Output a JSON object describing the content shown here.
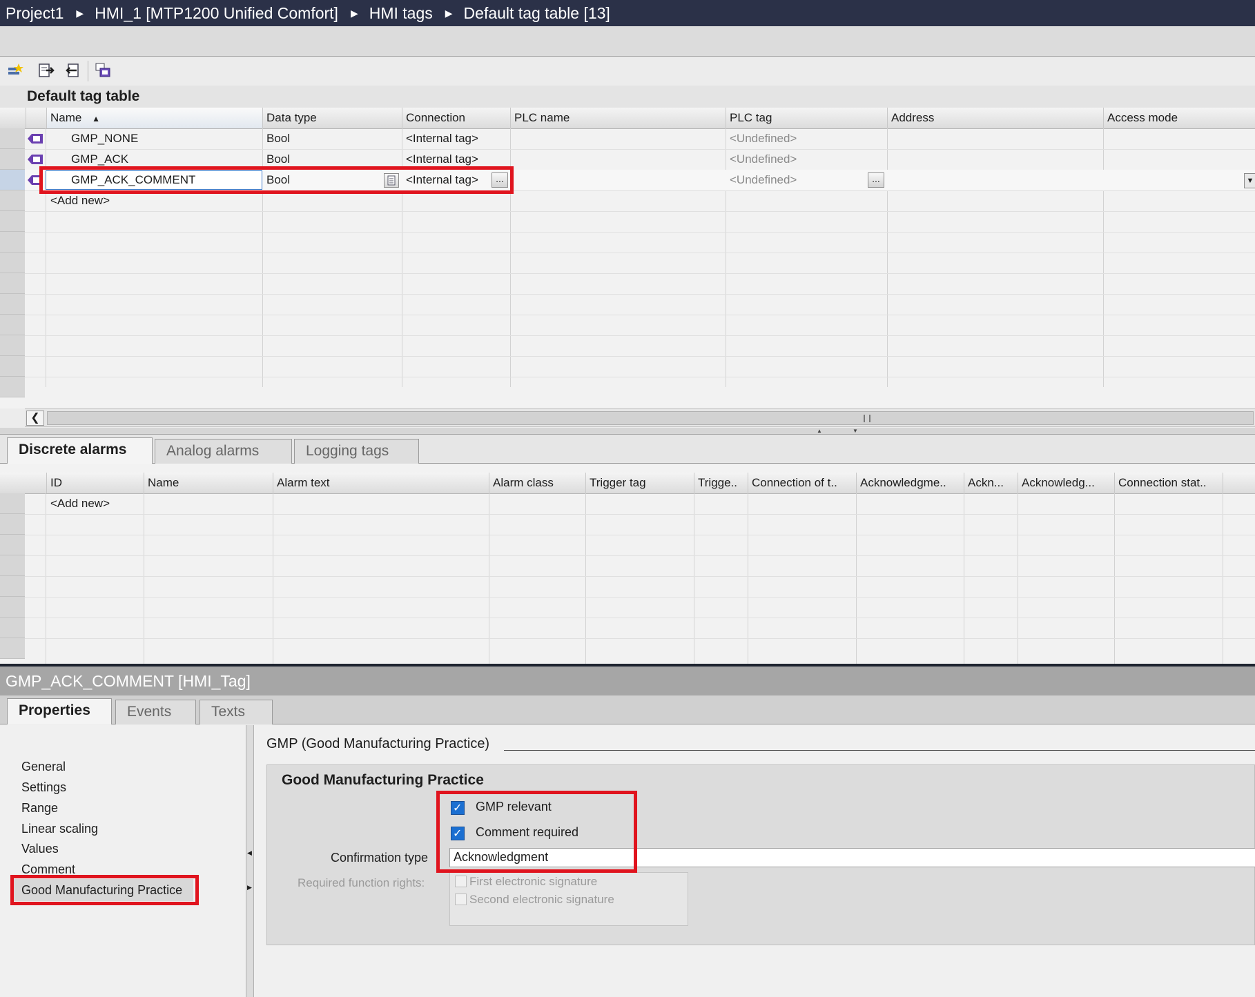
{
  "breadcrumb": [
    "Project1",
    "HMI_1 [MTP1200 Unified Comfort]",
    "HMI tags",
    "Default tag table [13]"
  ],
  "toolbar": {
    "icons": [
      "add-tag-icon",
      "export-icon",
      "import-icon",
      "tag-table-icon"
    ]
  },
  "tag_table": {
    "title": "Default tag table",
    "columns": [
      "Name",
      "Data type",
      "Connection",
      "PLC name",
      "PLC tag",
      "Address",
      "Access mode"
    ],
    "rows": [
      {
        "name": "GMP_NONE",
        "data_type": "Bool",
        "connection": "<Internal tag>",
        "plc_name": "",
        "plc_tag": "<Undefined>",
        "address": "",
        "access_mode": ""
      },
      {
        "name": "GMP_ACK",
        "data_type": "Bool",
        "connection": "<Internal tag>",
        "plc_name": "",
        "plc_tag": "<Undefined>",
        "address": "",
        "access_mode": ""
      },
      {
        "name": "GMP_ACK_COMMENT",
        "data_type": "Bool",
        "connection": "<Internal tag>",
        "plc_name": "",
        "plc_tag": "<Undefined>",
        "address": "",
        "access_mode": ""
      }
    ],
    "add_new": "<Add new>",
    "selected_row": "GMP_ACK_COMMENT",
    "ellipsis": "..."
  },
  "alarm_tabs": [
    "Discrete alarms",
    "Analog alarms",
    "Logging tags"
  ],
  "alarm_table": {
    "columns": [
      "ID",
      "Name",
      "Alarm text",
      "Alarm class",
      "Trigger tag",
      "Trigge..",
      "Connection of t..",
      "Acknowledgme..",
      "Ackn...",
      "Acknowledg...",
      "Connection stat.."
    ],
    "add_new": "<Add new>"
  },
  "properties": {
    "title": "GMP_ACK_COMMENT [HMI_Tag]",
    "tabs": [
      "Properties",
      "Events",
      "Texts"
    ],
    "nav": [
      "General",
      "Settings",
      "Range",
      "Linear scaling",
      "Values",
      "Comment",
      "Good Manufacturing Practice"
    ],
    "section_title": "GMP (Good Manufacturing Practice)",
    "group_title": "Good Manufacturing Practice",
    "gmp_relevant_label": "GMP relevant",
    "gmp_relevant": true,
    "comment_required_label": "Comment required",
    "comment_required": true,
    "confirmation_type_label": "Confirmation type",
    "confirmation_type": "Acknowledgment",
    "required_rights_label": "Required function rights:",
    "first_signature_label": "First electronic signature",
    "first_signature": false,
    "second_signature_label": "Second electronic signature",
    "second_signature": false
  },
  "colors": {
    "titlebar": "#2b3148",
    "highlight": "#e0141e",
    "checkbox": "#1b6fd1"
  }
}
